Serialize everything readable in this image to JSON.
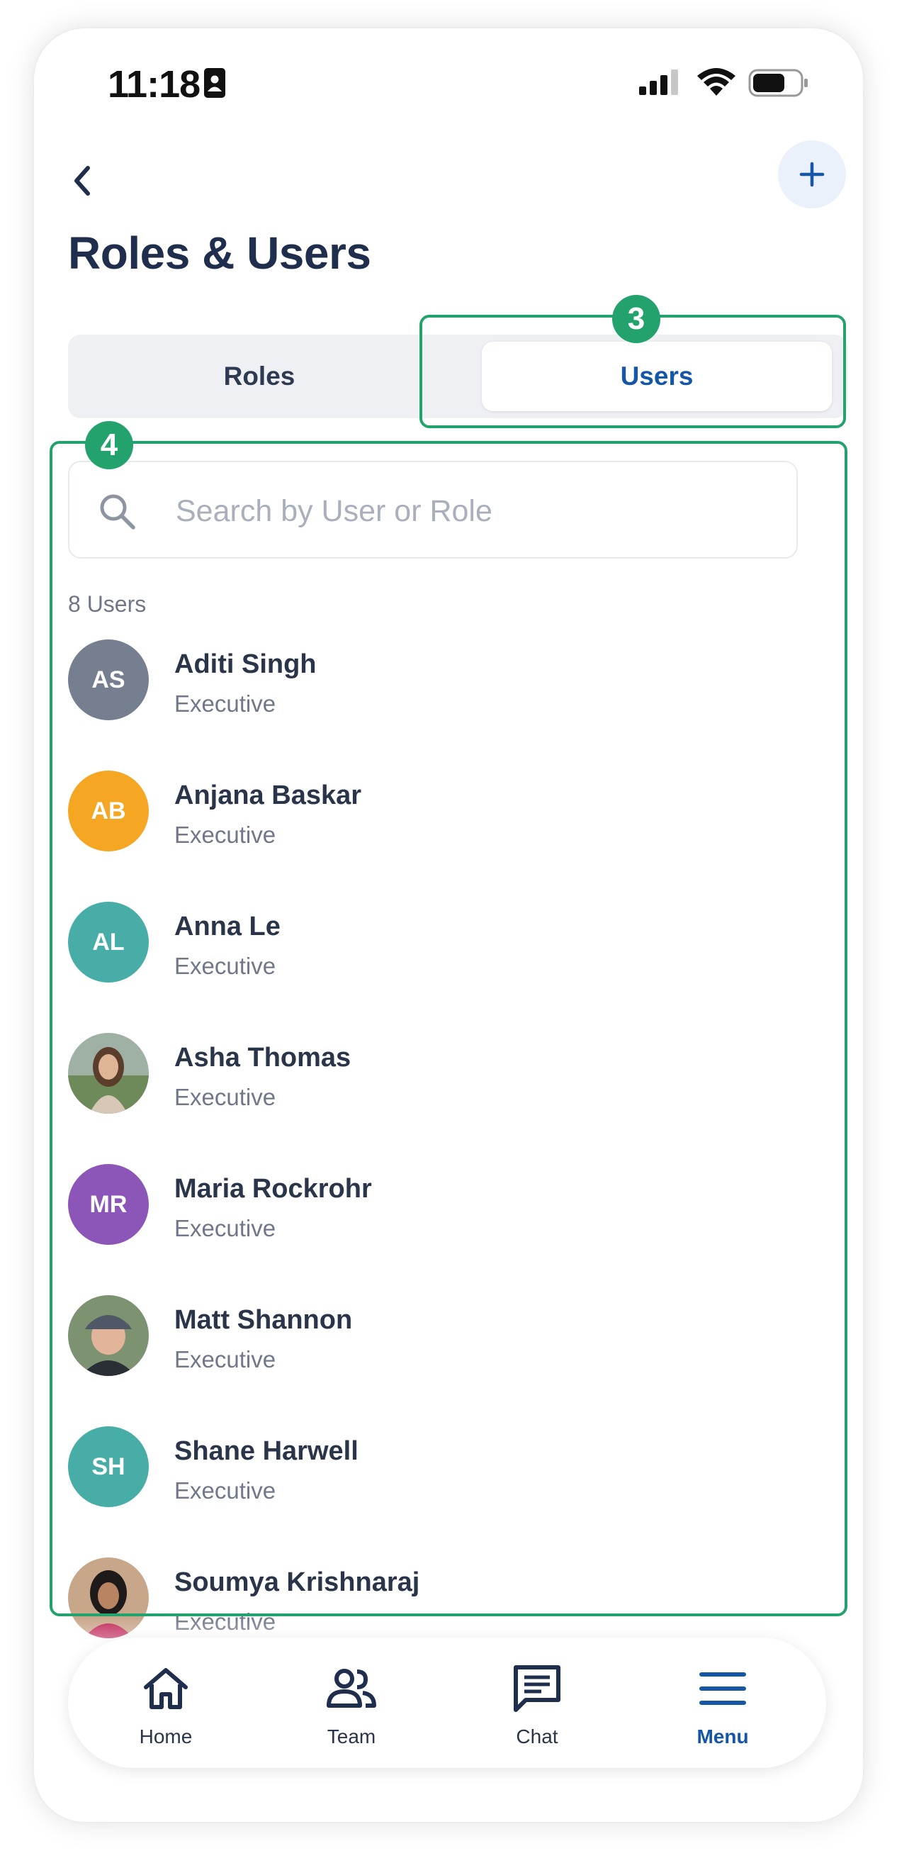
{
  "status_bar": {
    "time": "11:18"
  },
  "header": {
    "title": "Roles & Users"
  },
  "tabs": [
    {
      "label": "Roles",
      "active": false
    },
    {
      "label": "Users",
      "active": true
    }
  ],
  "callouts": [
    "3",
    "4"
  ],
  "search": {
    "placeholder": "Search by User or Role",
    "value": ""
  },
  "user_count": "8 Users",
  "users": [
    {
      "initials": "AS",
      "name": "Aditi Singh",
      "role": "Executive",
      "avatar_color": "#757f8f",
      "photo": false
    },
    {
      "initials": "AB",
      "name": "Anjana Baskar",
      "role": "Executive",
      "avatar_color": "#f5a623",
      "photo": false
    },
    {
      "initials": "AL",
      "name": "Anna Le",
      "role": "Executive",
      "avatar_color": "#48ada7",
      "photo": false
    },
    {
      "initials": "",
      "name": "Asha Thomas",
      "role": "Executive",
      "avatar_color": "#8a9b86",
      "photo": true
    },
    {
      "initials": "MR",
      "name": "Maria Rockrohr",
      "role": "Executive",
      "avatar_color": "#8c56b8",
      "photo": false
    },
    {
      "initials": "",
      "name": "Matt Shannon",
      "role": "Executive",
      "avatar_color": "#5e6a63",
      "photo": true
    },
    {
      "initials": "SH",
      "name": "Shane Harwell",
      "role": "Executive",
      "avatar_color": "#48ada7",
      "photo": false
    },
    {
      "initials": "",
      "name": "Soumya Krishnaraj",
      "role": "Executive",
      "avatar_color": "#a4544f",
      "photo": true
    }
  ],
  "bottom_nav": [
    {
      "label": "Home",
      "icon": "home-icon",
      "active": false
    },
    {
      "label": "Team",
      "icon": "team-icon",
      "active": false
    },
    {
      "label": "Chat",
      "icon": "chat-icon",
      "active": false
    },
    {
      "label": "Menu",
      "icon": "menu-icon",
      "active": true
    }
  ],
  "colors": {
    "accent": "#1556a6",
    "callout": "#23a26d",
    "title": "#1f2e4d"
  }
}
